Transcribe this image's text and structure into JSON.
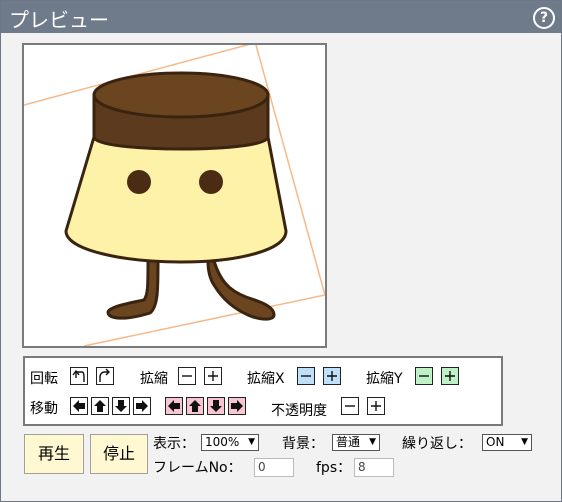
{
  "window": {
    "title": "プレビュー",
    "help_label": "?"
  },
  "controls": {
    "rotate_label": "回転",
    "scale_label": "拡縮",
    "scale_x_label": "拡縮X",
    "scale_y_label": "拡縮Y",
    "move_label": "移動",
    "opacity_label": "不透明度"
  },
  "playback": {
    "play_label": "再生",
    "stop_label": "停止",
    "display_label": "表示：",
    "display_value": "100%",
    "background_label": "背景：",
    "background_value": "普通",
    "repeat_label": "繰り返し：",
    "repeat_value": "ON",
    "frame_label": "フレームNo：",
    "frame_value": "0",
    "fps_label": "fps：",
    "fps_value": "8"
  },
  "colors": {
    "titlebar": "#6f7b8b",
    "pudding_top": "#5b3a1e",
    "pudding_body": "#fdf2a8",
    "frame_line": "#f5b98a"
  }
}
